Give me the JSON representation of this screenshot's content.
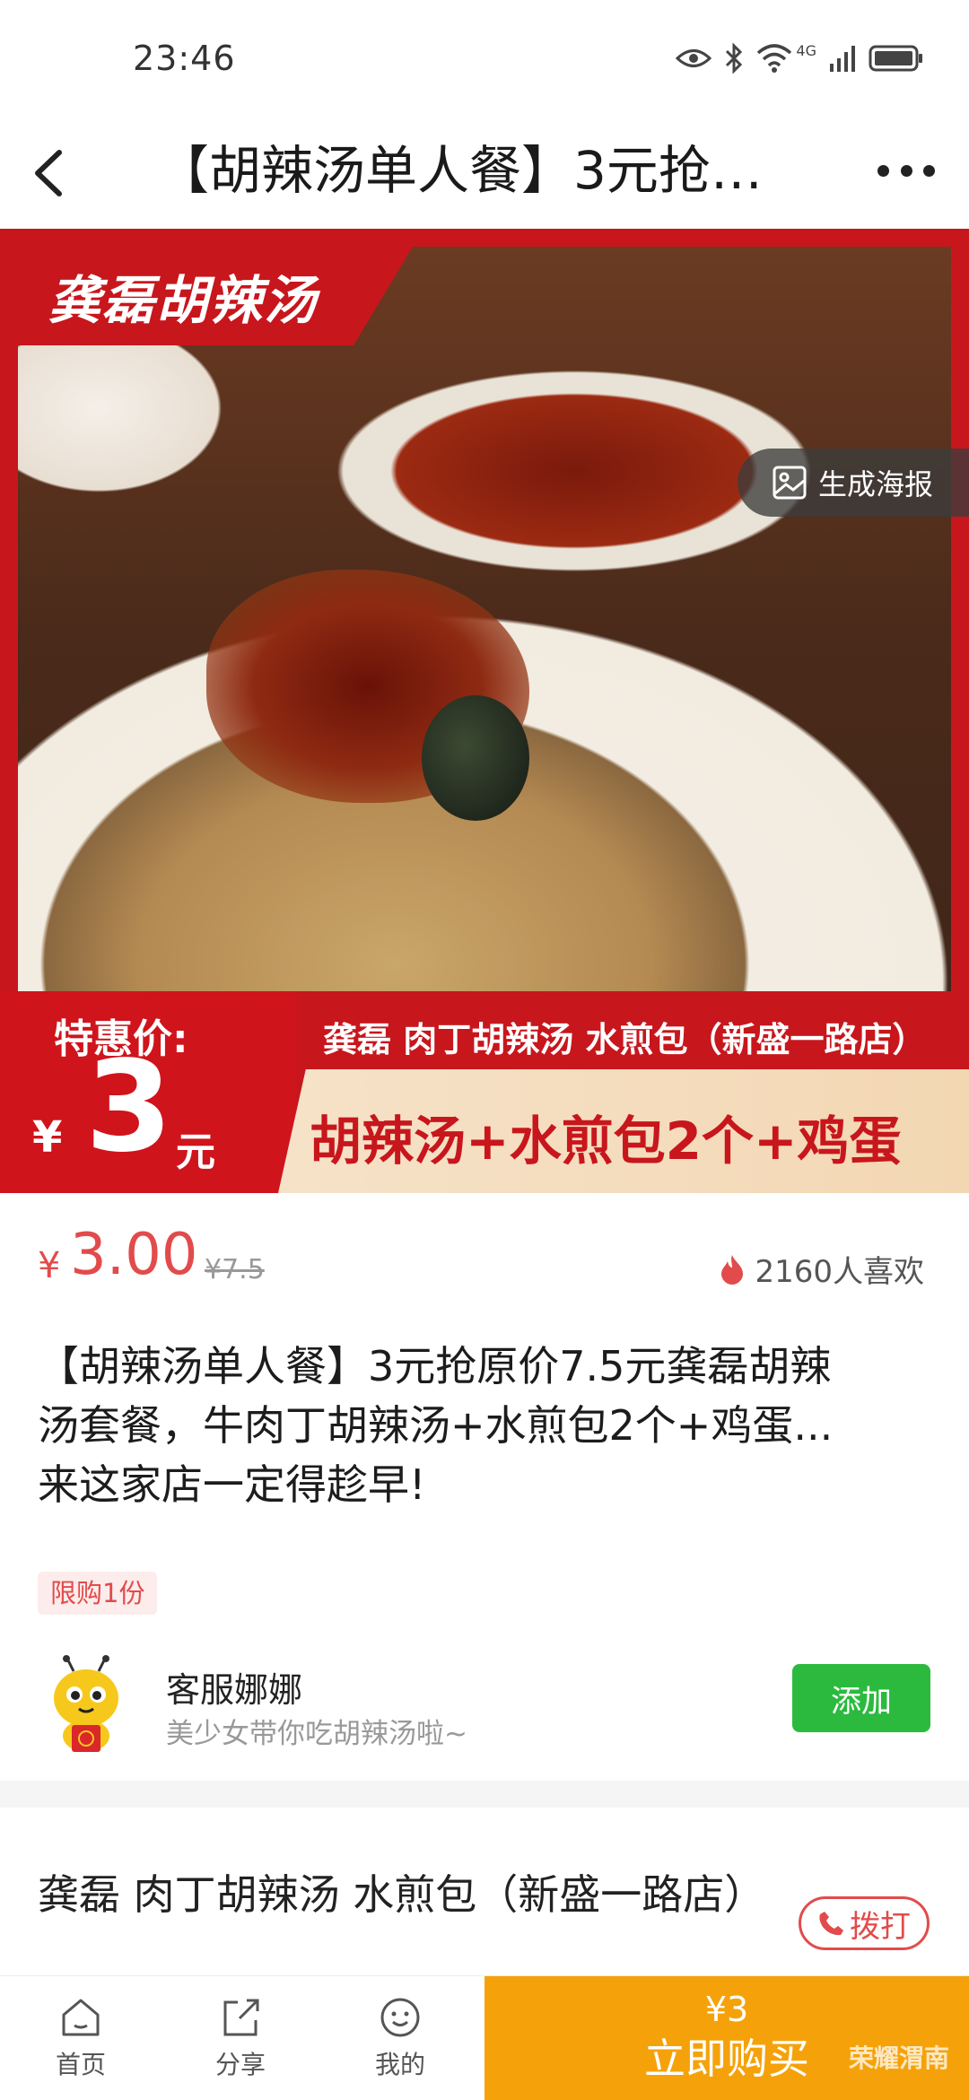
{
  "status_bar": {
    "time": "23:46",
    "network": "4G",
    "icons": [
      "eye-icon",
      "bluetooth-icon",
      "wifi-icon",
      "signal-icon",
      "battery-icon"
    ]
  },
  "header": {
    "title": "【胡辣汤单人餐】3元抢…",
    "back_icon": "chevron-left-icon",
    "more_icon": "more-dots-icon"
  },
  "hero": {
    "brand": "龚磊胡辣汤",
    "poster_button": "生成海报",
    "price_label": "特惠价:",
    "price_yen": "¥",
    "price_value": "3",
    "price_unit": "元",
    "shop_banner": "龚磊 肉丁胡辣汤 水煎包（新盛一路店）",
    "combo": "胡辣汤+水煎包2个+鸡蛋"
  },
  "price": {
    "currency": "¥",
    "current": "3.00",
    "original": "¥7.5",
    "likes": "2160人喜欢"
  },
  "description": {
    "line1": "【胡辣汤单人餐】3元抢原价7.5元龚磊胡辣",
    "line2": "汤套餐，牛肉丁胡辣汤+水煎包2个+鸡蛋...",
    "line3": "来这家店一定得趁早!"
  },
  "limit_tag": "限购1份",
  "customer_service": {
    "name": "客服娜娜",
    "subtitle": "美少女带你吃胡辣汤啦~",
    "add_button": "添加"
  },
  "shop": {
    "name": "龚磊 肉丁胡辣汤 水煎包（新盛一路店）",
    "call_button": "拨打"
  },
  "bottom_nav": {
    "items": [
      {
        "label": "首页",
        "icon": "home-icon"
      },
      {
        "label": "分享",
        "icon": "share-icon"
      },
      {
        "label": "我的",
        "icon": "profile-icon"
      }
    ],
    "buy_price": "¥3",
    "buy_label": "立即购买"
  },
  "watermark": "荣耀渭南",
  "colors": {
    "accent_red": "#e24b4b",
    "banner_red": "#c8161d",
    "buy_orange": "#f5a20a",
    "add_green": "#2bba3e"
  }
}
